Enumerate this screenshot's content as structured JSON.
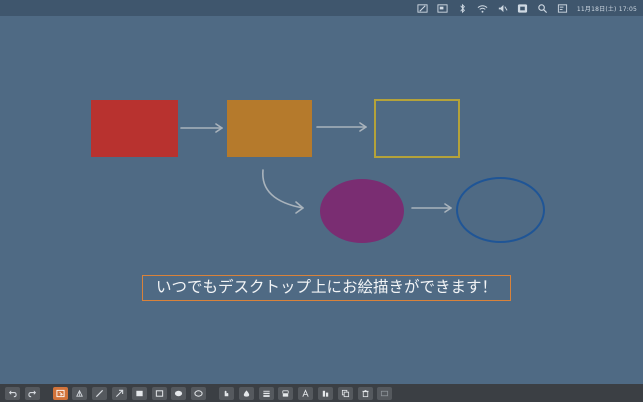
{
  "menubar": {
    "icons": [
      "pen-icon",
      "screen-icon",
      "bluetooth-icon",
      "wifi-icon",
      "volume-icon",
      "input-source-icon",
      "search-icon",
      "notification-icon"
    ],
    "clock": "11月18日(土) 17:05"
  },
  "canvas": {
    "background": "#4f6a84",
    "caption": "いつでもデスクトップ上にお絵描きができます！",
    "caption_border": "#d9823a",
    "shapes": [
      {
        "name": "red-rectangle",
        "kind": "filled-rect",
        "color": "#b8322f"
      },
      {
        "name": "orange-rectangle",
        "kind": "filled-rect",
        "color": "#b57a2c"
      },
      {
        "name": "yellow-outline-rectangle",
        "kind": "outline-rect",
        "color": "#b4a23a"
      },
      {
        "name": "purple-ellipse",
        "kind": "filled-ellipse",
        "color": "#7a2d72"
      },
      {
        "name": "blue-outline-ellipse",
        "kind": "outline-ellipse",
        "color": "#1f5596"
      }
    ],
    "arrow_color": "#a9b3bc"
  },
  "toolbar": {
    "buttons": [
      "undo-icon",
      "redo-icon",
      "select-icon",
      "highlighter-icon",
      "line-icon",
      "arrow-icon",
      "filled-rect-icon",
      "outline-rect-icon",
      "filled-ellipse-icon",
      "outline-ellipse-icon",
      "stamp-icon",
      "fill-icon",
      "stroke-width-icon",
      "layer-icon",
      "text-icon",
      "align-icon",
      "copy-icon",
      "delete-icon",
      "settings-icon"
    ],
    "active": "select-icon"
  }
}
